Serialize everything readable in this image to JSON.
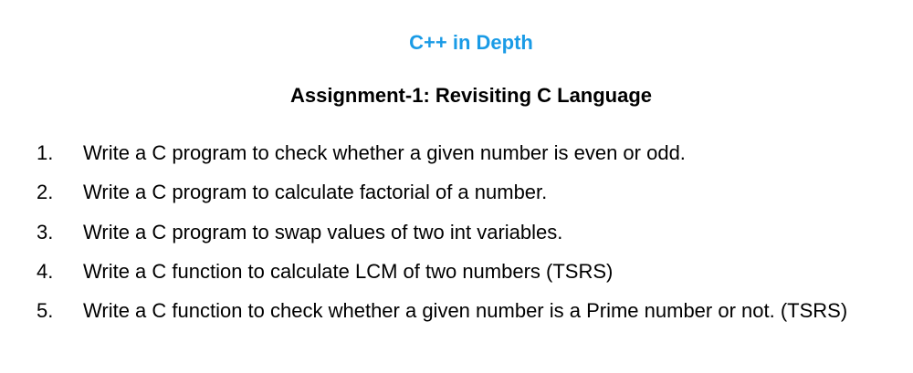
{
  "document": {
    "title": "C++ in Depth",
    "subtitle": "Assignment-1: Revisiting C Language",
    "title_color": "#1a9be6",
    "tasks": [
      {
        "number": "1.",
        "text": "Write a C program to check whether a given number is even or odd."
      },
      {
        "number": "2.",
        "text": "Write a C program to calculate factorial of a number."
      },
      {
        "number": "3.",
        "text": "Write a C program to swap values of two int variables."
      },
      {
        "number": "4.",
        "text": "Write a C function to calculate LCM of two numbers (TSRS)"
      },
      {
        "number": "5.",
        "text": "Write a C function to check whether a given number is a Prime number or not. (TSRS)"
      }
    ]
  }
}
